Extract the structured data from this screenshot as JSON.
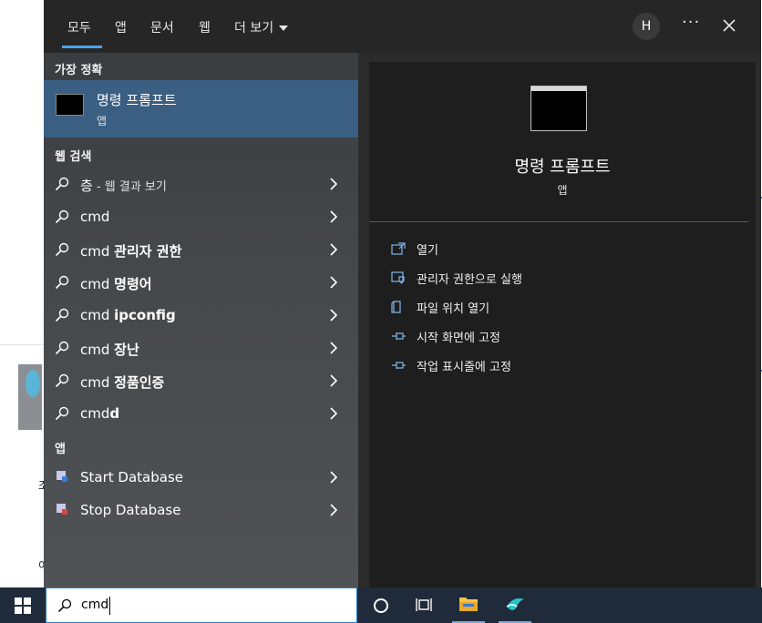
{
  "tabs": [
    "모두",
    "앱",
    "문서",
    "웹"
  ],
  "more_tab": "더 보기",
  "avatar_letter": "H",
  "more_options": "···",
  "section_best": "가장 정확",
  "best": {
    "title": "명령 프롬프트",
    "type": "앱"
  },
  "section_web": "웹 검색",
  "web_first": {
    "term": "층",
    "suffix": " - 웹 결과 보기"
  },
  "web_results": [
    {
      "prefix": "cmd",
      "bold": ""
    },
    {
      "prefix": "cmd ",
      "bold": "관리자 권한"
    },
    {
      "prefix": "cmd ",
      "bold": "명령어"
    },
    {
      "prefix": "cmd ",
      "bold": "ipconfig"
    },
    {
      "prefix": "cmd ",
      "bold": "장난"
    },
    {
      "prefix": "cmd ",
      "bold": "정품인증"
    },
    {
      "prefix": "cmd",
      "bold": "d"
    }
  ],
  "section_apps": "앱",
  "apps": [
    "Start Database",
    "Stop Database"
  ],
  "preview": {
    "title": "명령 프롬프트",
    "type": "앱"
  },
  "actions": [
    "열기",
    "관리자 권한으로 실행",
    "파일 위치 열기",
    "시작 화면에 고정",
    "작업 표시줄에 고정"
  ],
  "search": {
    "value": "cmd"
  },
  "background": {
    "glyph1": "조",
    "glyph2": "이"
  },
  "colors": {
    "accent": "#4ba3f0",
    "selected": "#3b5f83",
    "taskbar": "#1f2b3a"
  }
}
